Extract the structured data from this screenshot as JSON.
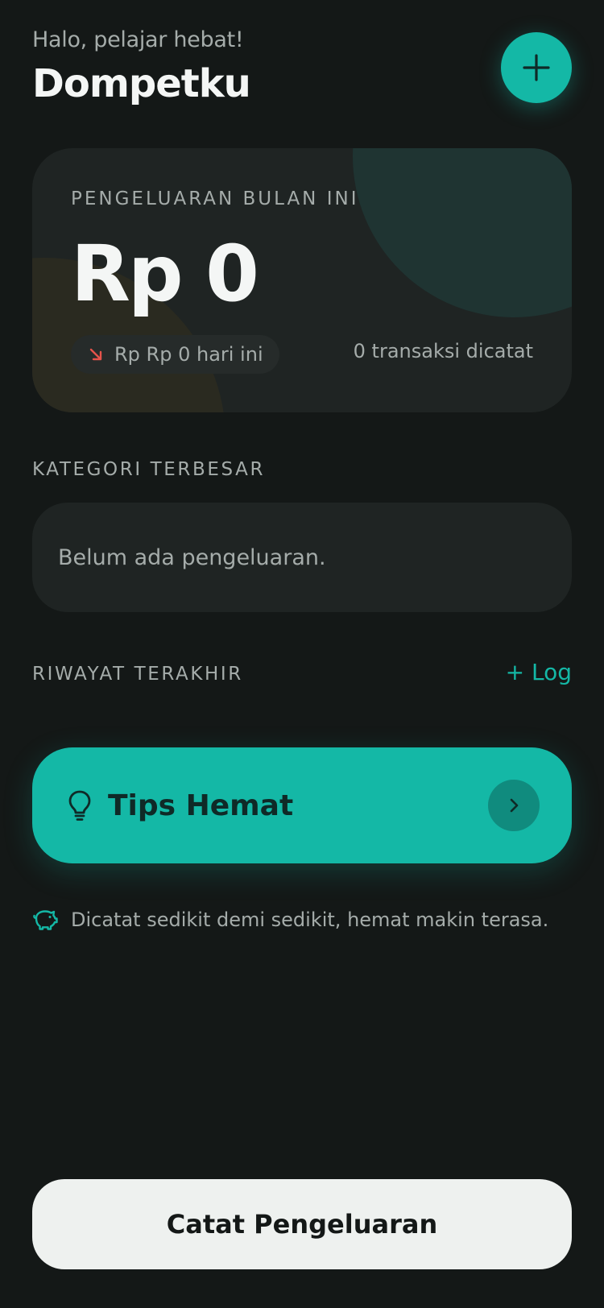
{
  "header": {
    "greeting": "Halo, pelajar hebat!",
    "title": "Dompetku",
    "add_icon": "plus-icon"
  },
  "summary": {
    "label": "PENGELUARAN BULAN INI",
    "amount": "Rp 0",
    "today": "Rp Rp 0 hari ini",
    "today_icon": "arrow-down-right-icon",
    "transactions": "0 transaksi dicatat"
  },
  "categories": {
    "label": "KATEGORI TERBESAR",
    "empty": "Belum ada pengeluaran."
  },
  "history": {
    "label": "RIWAYAT TERAKHIR",
    "add_link": "+ Log"
  },
  "tips": {
    "title": "Tips Hemat",
    "icon": "lightbulb-icon",
    "arrow_icon": "chevron-right-icon"
  },
  "footer_note": {
    "icon": "piggy-bank-icon",
    "text": "Dicatat sedikit demi sedikit, hemat makin terasa."
  },
  "cta": {
    "label": "Catat Pengeluaran"
  },
  "colors": {
    "background": "#141817",
    "card": "#1f2423",
    "accent": "#14b8a6",
    "negative": "#e5534b",
    "muted_text": "#a5acaa"
  }
}
